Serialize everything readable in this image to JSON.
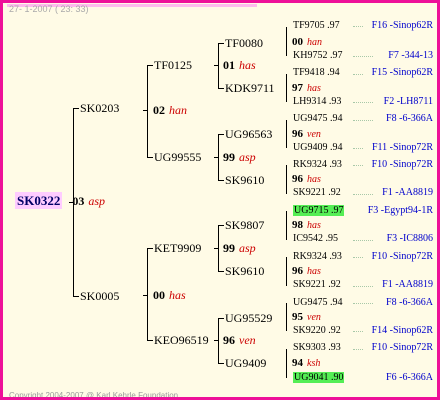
{
  "header": {
    "date": "27-  1-2007 ( 23: 33)"
  },
  "footer": {
    "copyright": "Copyright 2004-2007 @ Karl Kehrle Foundation."
  },
  "root": {
    "id": "SK0322",
    "num": "03",
    "breeder": "asp"
  },
  "gen1": [
    {
      "id": "SK0203",
      "num": "02",
      "breeder": "han"
    },
    {
      "id": "SK0005",
      "num": "00",
      "breeder": "has"
    }
  ],
  "gen2": [
    {
      "id": "TF0125",
      "num": "01",
      "breeder": "has"
    },
    {
      "id": "UG99555",
      "num": "99",
      "breeder": "asp"
    },
    {
      "id": "KET9909",
      "num": "99",
      "breeder": "asp"
    },
    {
      "id": "KEO96519",
      "num": "96",
      "breeder": "ven"
    }
  ],
  "gen3": [
    {
      "id": "TF0080",
      "num": "00",
      "breeder": "han"
    },
    {
      "id": "KDK9711",
      "num": "97",
      "breeder": "has"
    },
    {
      "id": "UG96563",
      "num": "96",
      "breeder": "ven"
    },
    {
      "id": "SK9610",
      "num": "96",
      "breeder": "has"
    },
    {
      "id": "SK9807",
      "num": "98",
      "breeder": "has"
    },
    {
      "id": "SK9610",
      "num": "96",
      "breeder": "has"
    },
    {
      "id": "UG95529",
      "num": "95",
      "breeder": "ven"
    },
    {
      "id": "UG9409",
      "num": "94",
      "breeder": "ksh"
    }
  ],
  "gen4": [
    {
      "id": "TF9705",
      "year": ".97",
      "line": "F16 -Sinop62R"
    },
    {
      "id": "KH9752",
      "year": ".97",
      "line": "F7 -344-13"
    },
    {
      "id": "TF9418",
      "year": ".94",
      "line": "F15 -Sinop62R"
    },
    {
      "id": "LH9314",
      "year": ".93",
      "line": "F2 -LH8711"
    },
    {
      "id": "UG9475",
      "year": ".94",
      "line": "F8 -6-366A"
    },
    {
      "id": "UG9409",
      "year": ".94",
      "line": "F11 -Sinop72R"
    },
    {
      "id": "RK9324",
      "year": ".93",
      "line": "F10 -Sinop72R"
    },
    {
      "id": "SK9221",
      "year": ".92",
      "line": "F1 -AA8819"
    },
    {
      "id": "UG9715",
      "year": ".97",
      "line": "F3 -Egypt94-1R"
    },
    {
      "id": "IC9542",
      "year": ".95",
      "line": "F3 -IC8806"
    },
    {
      "id": "RK9324",
      "year": ".93",
      "line": "F10 -Sinop72R"
    },
    {
      "id": "SK9221",
      "year": ".92",
      "line": "F1 -AA8819"
    },
    {
      "id": "UG9475",
      "year": ".94",
      "line": "F8 -6-366A"
    },
    {
      "id": "SK9220",
      "year": ".92",
      "line": "F14 -Sinop62R"
    },
    {
      "id": "SK9303",
      "year": ".93",
      "line": "F10 -Sinop72R"
    },
    {
      "id": "UG9041",
      "year": ".90",
      "line": "F6 -6-366A"
    }
  ],
  "colors": {
    "border": "#ee1199",
    "background": "#fffbe6",
    "highlight": "#55ee55",
    "focus": "#ffccff"
  }
}
